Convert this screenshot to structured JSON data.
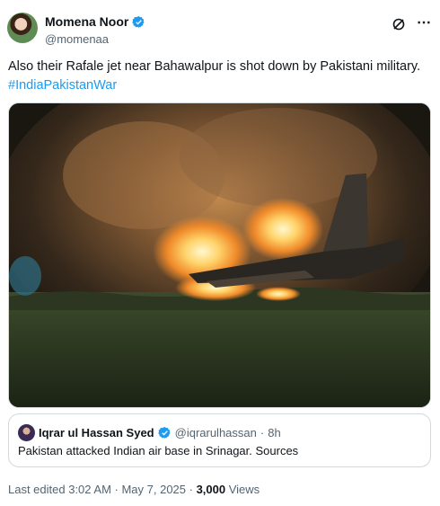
{
  "author": {
    "display_name": "Momena Noor",
    "handle": "@momenaa",
    "verified": true
  },
  "icons": {
    "grok": "grok-icon",
    "more": "more-icon",
    "verified": "verified-badge-icon"
  },
  "colors": {
    "link": "#1d9bf0",
    "secondary_text": "#536471",
    "border": "#cfd9de"
  },
  "tweet": {
    "text": "Also their Rafale jet near Bahawalpur is shot down by Pakistani military.",
    "hashtag": "#IndiaPakistanWar"
  },
  "media": {
    "type": "photo"
  },
  "quote": {
    "display_name": "Iqrar ul Hassan Syed",
    "handle": "@iqrarulhassan",
    "separator": "·",
    "time": "8h",
    "text": "Pakistan attacked Indian air base in Srinagar. Sources"
  },
  "meta": {
    "edited_label": "Last edited 3:02 AM · May 7, 2025 · ",
    "views_count": "3,000",
    "views_label": " Views"
  }
}
